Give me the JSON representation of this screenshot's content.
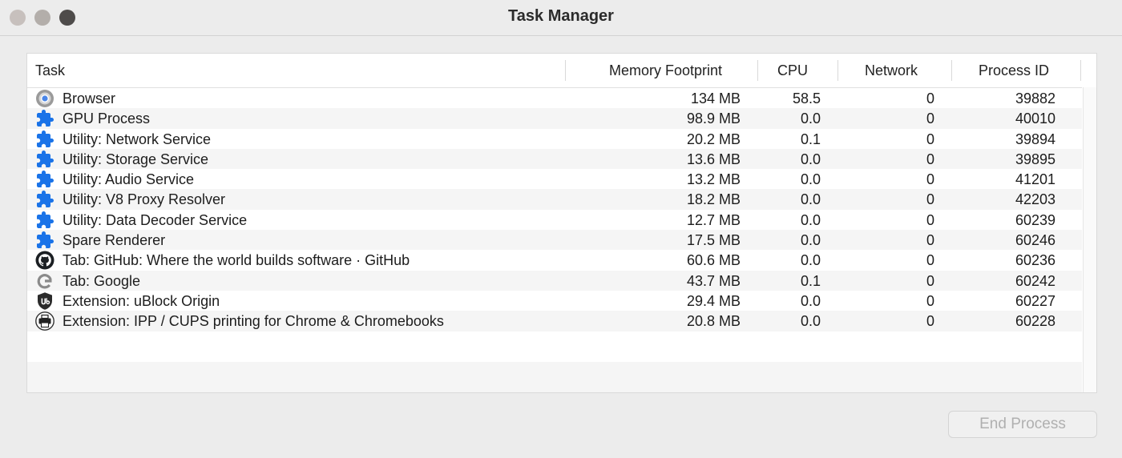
{
  "window": {
    "title": "Task Manager"
  },
  "columns": {
    "task": "Task",
    "memory": "Memory Footprint",
    "cpu": "CPU",
    "network": "Network",
    "pid": "Process ID"
  },
  "rows": [
    {
      "icon": "chrome-browser-icon",
      "task": "Browser",
      "memory": "134 MB",
      "cpu": "58.5",
      "network": "0",
      "pid": "39882"
    },
    {
      "icon": "puzzle-piece-icon",
      "task": "GPU Process",
      "memory": "98.9 MB",
      "cpu": "0.0",
      "network": "0",
      "pid": "40010"
    },
    {
      "icon": "puzzle-piece-icon",
      "task": "Utility: Network Service",
      "memory": "20.2 MB",
      "cpu": "0.1",
      "network": "0",
      "pid": "39894"
    },
    {
      "icon": "puzzle-piece-icon",
      "task": "Utility: Storage Service",
      "memory": "13.6 MB",
      "cpu": "0.0",
      "network": "0",
      "pid": "39895"
    },
    {
      "icon": "puzzle-piece-icon",
      "task": "Utility: Audio Service",
      "memory": "13.2 MB",
      "cpu": "0.0",
      "network": "0",
      "pid": "41201"
    },
    {
      "icon": "puzzle-piece-icon",
      "task": "Utility: V8 Proxy Resolver",
      "memory": "18.2 MB",
      "cpu": "0.0",
      "network": "0",
      "pid": "42203"
    },
    {
      "icon": "puzzle-piece-icon",
      "task": "Utility: Data Decoder Service",
      "memory": "12.7 MB",
      "cpu": "0.0",
      "network": "0",
      "pid": "60239"
    },
    {
      "icon": "puzzle-piece-icon",
      "task": "Spare Renderer",
      "memory": "17.5 MB",
      "cpu": "0.0",
      "network": "0",
      "pid": "60246"
    },
    {
      "icon": "github-icon",
      "task": "Tab: GitHub: Where the world builds software · GitHub",
      "memory": "60.6 MB",
      "cpu": "0.0",
      "network": "0",
      "pid": "60236"
    },
    {
      "icon": "google-icon",
      "task": "Tab: Google",
      "memory": "43.7 MB",
      "cpu": "0.1",
      "network": "0",
      "pid": "60242"
    },
    {
      "icon": "ublock-origin-icon",
      "task": "Extension: uBlock Origin",
      "memory": "29.4 MB",
      "cpu": "0.0",
      "network": "0",
      "pid": "60227"
    },
    {
      "icon": "ipp-printer-icon",
      "task": "Extension: IPP / CUPS printing for Chrome & Chromebooks",
      "memory": "20.8 MB",
      "cpu": "0.0",
      "network": "0",
      "pid": "60228"
    }
  ],
  "footer": {
    "end_process_label": "End Process"
  },
  "colors": {
    "puzzle_blue": "#1a73e8",
    "window_bg": "#ececec"
  }
}
